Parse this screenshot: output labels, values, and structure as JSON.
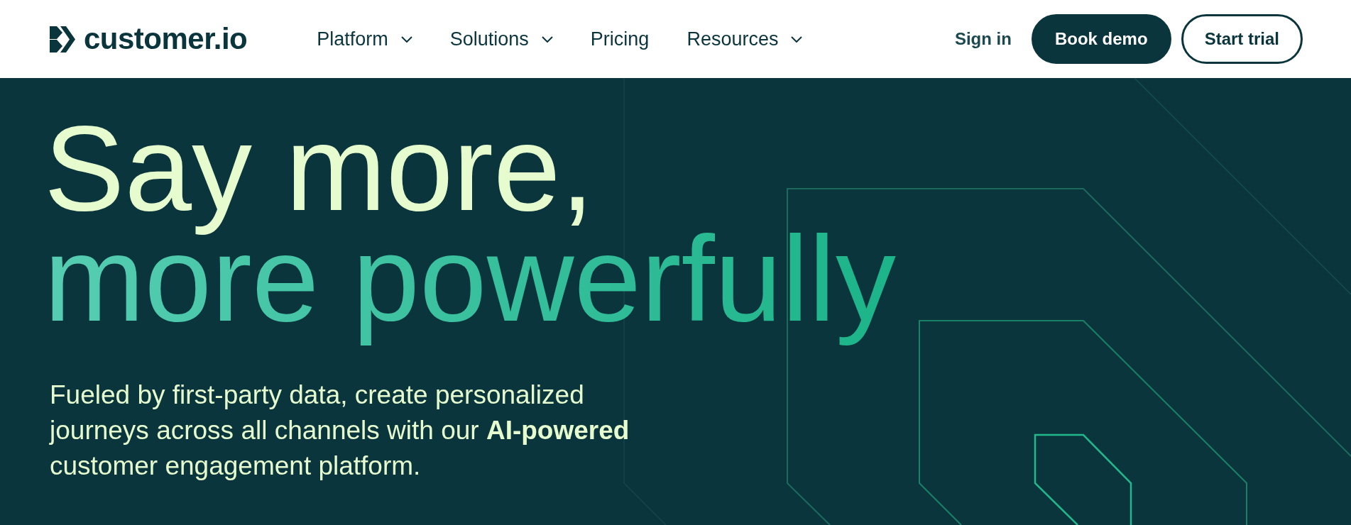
{
  "header": {
    "logo": {
      "text": "customer.io"
    },
    "nav": [
      {
        "label": "Platform",
        "has_menu": true
      },
      {
        "label": "Solutions",
        "has_menu": true
      },
      {
        "label": "Pricing",
        "has_menu": false
      },
      {
        "label": "Resources",
        "has_menu": true
      }
    ],
    "sign_in": "Sign in",
    "buttons": [
      {
        "label": "Book demo",
        "kind": "primary"
      },
      {
        "label": "Start trial",
        "kind": "outline"
      }
    ]
  },
  "hero": {
    "headline": [
      {
        "text": "Say more,",
        "kind": "plain"
      },
      {
        "text": "more powerfully",
        "kind": "gradient"
      }
    ],
    "subtitle": "Fueled by first-party data, create personalized journeys across all channels with our **AI-powered** customer engagement platform."
  }
}
